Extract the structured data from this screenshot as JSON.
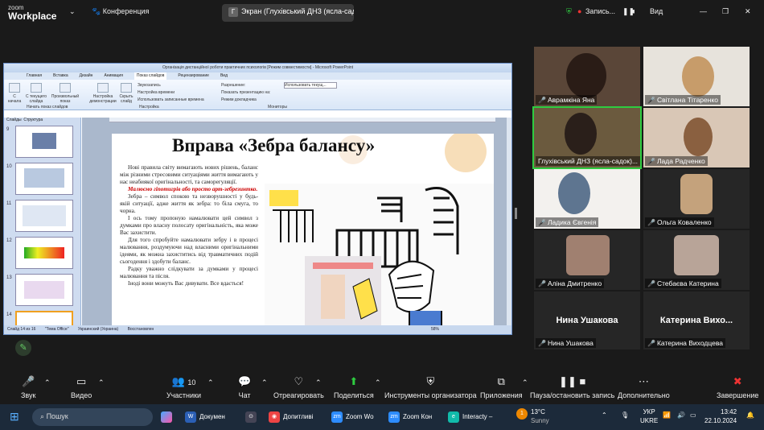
{
  "zoom": {
    "logo": {
      "line1": "zoom",
      "line2": "Workplace"
    },
    "meeting_label": "Конференция",
    "share_label": "Экран (Глухівський ДНЗ (ясла-садок)...",
    "recording_label": "Запись...",
    "view_label": "Вид",
    "participants_count": "10"
  },
  "ppt": {
    "window_title": "Організація дистанційної роботи практичних психологів [Режим совместимости] - Microsoft PowerPoint",
    "tabs": [
      "Главная",
      "Вставка",
      "Дизайн",
      "Анимация",
      "Показ слайдов",
      "Рецензирование",
      "Вид"
    ],
    "active_tab": "Показ слайдов",
    "ribbon": {
      "from_start": "С начала",
      "from_current": "С текущего слайда",
      "custom": "Произвольный показ",
      "setup": "Настройка демонстрации",
      "hide": "Скрыть слайд",
      "record": "Звукозапись",
      "rehearse": "Настройка времени",
      "use_timings": "Использовать записанные времена",
      "resolution": "Разрешение:",
      "resolution_value": "Использовать текущ...",
      "show_on": "Показать презентацию на:",
      "presenter_view": "Режим докладчика",
      "group1": "Начать показ слайдов",
      "group2": "Настройка",
      "group3": "Мониторы"
    },
    "left_tabs": [
      "Слайды",
      "Структура"
    ],
    "thumb_numbers": [
      "9",
      "10",
      "11",
      "12",
      "13",
      "14"
    ],
    "status": [
      "Слайд 14 из 16",
      "\"Тема Office\"",
      "Украинский (Украина)",
      "Восстановлен"
    ],
    "zoom_pct": "58%"
  },
  "slide": {
    "title": "Вправа «Зебра балансу»",
    "p1": "Нові правила світу вимагають нових рішень, баланс між різними стресовими ситуаціями життя вимагають у нас неабиякої оригінальності, та саморегуляції.",
    "p2_red": "Малюємо гіпотигрів або просто арт-зебрезинтко.",
    "p3": "Зебра – символ спокою та незворушності у будь-якій ситуації, адже життя як зебра: то біла смуга, то чорна.",
    "p4": "І ось тому пропоную намалювати цей символ з думками про власну полосату оригінальність, яка може Вас захистити.",
    "p5": "Для того спробуйте намалювати зебру і в процесі малювання, роздумуючи над власними оригінальними ідеями, як можна захиститись від травматичних подій сьогодення і здобути баланс.",
    "p6": "Радку уважно слідкувати за думками у процесі малювання та після.",
    "p7": "Іноді вони можуть Вас дивувати. Все вдасться!"
  },
  "participants": [
    {
      "name": "Аврамкіна Яна",
      "muted": true
    },
    {
      "name": "Світлана Тітаренко",
      "muted": true
    },
    {
      "name": "Глухівський ДНЗ (ясла-садок)...",
      "muted": false
    },
    {
      "name": "Лада Радченко",
      "muted": true
    },
    {
      "name": "Ладика Євгенія",
      "muted": true
    },
    {
      "name": "Ольга Коваленко",
      "muted": true
    },
    {
      "name": "Аліна Дмитренко",
      "muted": true
    },
    {
      "name": "Стебаєва Катерина",
      "muted": true
    },
    {
      "name": "Нина Ушакова",
      "muted": true,
      "big": "Нина Ушакова"
    },
    {
      "name": "Катерина Виходцева",
      "muted": true,
      "big": "Катерина Вихо..."
    }
  ],
  "toolbar": {
    "audio": "Звук",
    "video": "Видео",
    "participants": "Участники",
    "chat": "Чат",
    "react": "Отреагировать",
    "share": "Поделиться",
    "host_tools": "Инструменты организатора",
    "apps": "Приложения",
    "pause_record": "Пауза/остановить запись",
    "more": "Дополнительно",
    "end": "Завершение"
  },
  "taskbar": {
    "search": "Пошук",
    "apps": [
      "Докумен",
      "Допитливі",
      "Zoom Wo",
      "Zoom Кон",
      "Interacty –"
    ],
    "weather_temp": "13°C",
    "weather_desc": "Sunny",
    "lang": "УКР",
    "lang2": "UKRE",
    "time": "13:42",
    "date": "22.10.2024",
    "notif": "1"
  }
}
